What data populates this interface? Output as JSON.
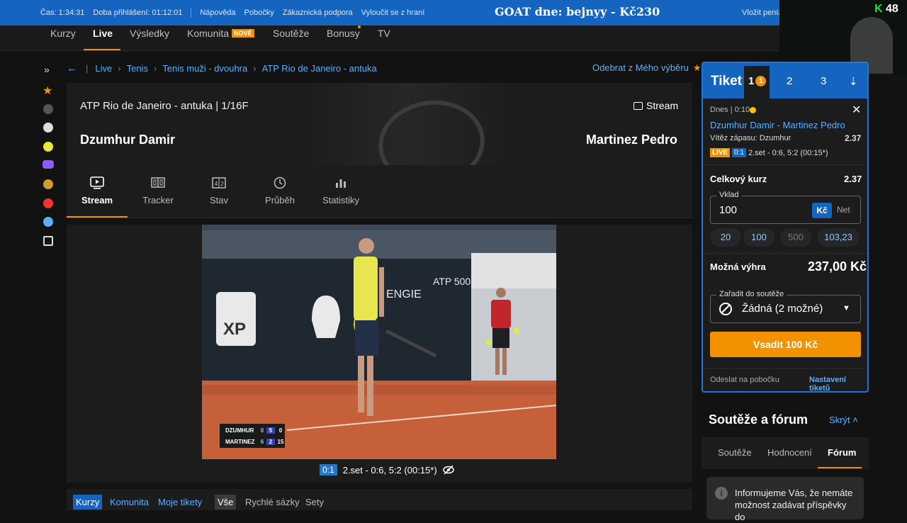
{
  "topbar": {
    "time": "Čas: 1:34:31",
    "login_duration": "Doba přihlášení: 01:12:01",
    "links": [
      "Nápověda",
      "Pobočky",
      "Zákaznická podpora",
      "Vyloučit se z hraní"
    ],
    "goat": "GOAT dne: bejnyy - Kč230",
    "right": "Vložit peníz"
  },
  "nav": {
    "items": [
      "Kurzy",
      "Live",
      "Výsledky",
      "Komunita",
      "Soutěže",
      "Bonusy",
      "TV"
    ],
    "new_badge": "NOVÉ",
    "active": "Live"
  },
  "webcam": {
    "badge_k": "K",
    "badge_num": "48"
  },
  "breadcrumb": [
    "Live",
    "Tenis",
    "Tenis muži - dvouhra",
    "ATP Rio de Janeiro - antuka"
  ],
  "remove_favorite": "Odebrat z Mého výběru",
  "match": {
    "tournament": "ATP Rio de Janeiro - antuka  |  1/16F",
    "stream_label": "Stream",
    "player1": "Dzumhur Damir",
    "player2": "Martinez Pedro"
  },
  "tabs": [
    "Stream",
    "Tracker",
    "Stav",
    "Průběh",
    "Statistiky"
  ],
  "scoreboard": {
    "rows": [
      {
        "name": "DZUMHUR",
        "sets": "0",
        "games": "5",
        "points": "0"
      },
      {
        "name": "MARTINEZ",
        "sets": "6",
        "games": "2",
        "points": "15"
      }
    ]
  },
  "video_banner": {
    "sponsors": [
      "XP",
      "ENGIE",
      "ATP 500"
    ]
  },
  "live_status": {
    "tag": "0:1",
    "text": "2.set - 0:6, 5:2 (00:15*)"
  },
  "bottom_tabs": {
    "left": [
      "Kurzy",
      "Komunita",
      "Moje tikety"
    ],
    "right": [
      "Vše",
      "Rychlé sázky",
      "Sety"
    ]
  },
  "ticket": {
    "title": "Tiket",
    "tabs": [
      "1",
      "2",
      "3"
    ],
    "badge": "1",
    "date": "Dnes | 0:10",
    "match": "Dzumhur Damir - Martinez Pedro",
    "market": "Vítěz zápasu: Dzumhur",
    "odds": "2.37",
    "live_tag": "LIVE",
    "score_tag": "0:1",
    "score": "2.set - 0:6, 5:2 (00:15*)",
    "total_label": "Celkový kurz",
    "total_odds": "2.37",
    "stake_label": "Vklad",
    "stake_value": "100",
    "currency_kc": "Kč",
    "currency_net": "Net",
    "quick_stakes": [
      "20",
      "100",
      "500",
      "103,23"
    ],
    "win_label": "Možná výhra",
    "win_value": "237,00 Kč",
    "contest_label": "Zařadit do soutěže",
    "contest_value": "Žádná (2 možné)",
    "bet_button": "Vsadit 100 Kč",
    "send_branch": "Odeslat na pobočku",
    "settings": "Nastavení tiketů"
  },
  "forum": {
    "title": "Soutěže a fórum",
    "hide": "Skrýt",
    "tabs": [
      "Soutěže",
      "Hodnocení",
      "Fórum"
    ],
    "info": "Informujeme Vás, že nemáte možnost zadávat příspěvky do"
  },
  "colors": {
    "brand_blue": "#1565c0",
    "accent_orange": "#f39200",
    "link_blue": "#5ab0ff"
  }
}
